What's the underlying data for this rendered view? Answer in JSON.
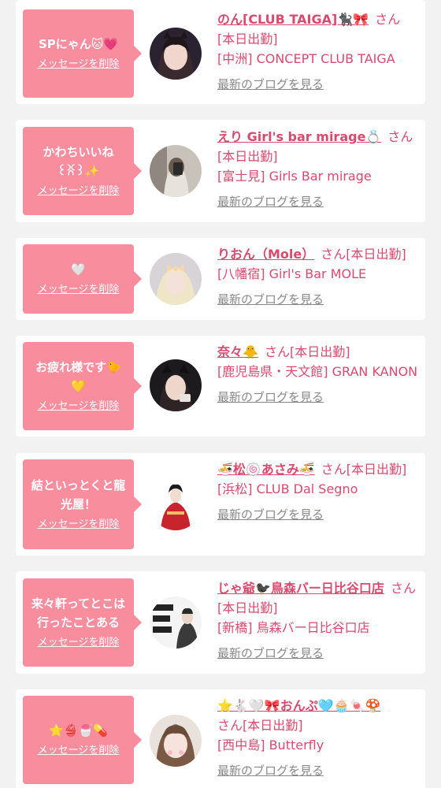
{
  "messages": [
    {
      "message": "SPにゃん🐱💗",
      "delete_label": "メッセージを削除",
      "name": "のん[CLUB TAIGA]🐈‍⬛🎀",
      "san": "さん",
      "status": "[本日出勤]",
      "shop": "[中洲] CONCEPT CLUB TAIGA",
      "blog_label": "最新のブログを見る"
    },
    {
      "message": "かわちいいね\n꒰ꐦ꒱✨",
      "delete_label": "メッセージを削除",
      "name": "えり Girl's bar mirage💍",
      "san": "さん",
      "status": "[本日出勤]",
      "shop": "[富士見] Girls Bar mirage",
      "blog_label": "最新のブログを見る"
    },
    {
      "message": "🤍",
      "delete_label": "メッセージを削除",
      "name": "りおん（Mole）",
      "san": "さん",
      "status": "[本日出勤]",
      "shop": "[八幡宿] Girl's Bar MOLE",
      "blog_label": "最新のブログを見る"
    },
    {
      "message": "お疲れ様です🐤\n💛",
      "delete_label": "メッセージを削除",
      "name": "奈々🐥",
      "san": "さん",
      "status": "[本日出勤]",
      "shop": "[鹿児島県・天文館] GRAN KANON",
      "blog_label": "最新のブログを見る"
    },
    {
      "message": "結といっとくと龍\n光屋！",
      "delete_label": "メッセージを削除",
      "name": "🍜松🍥あさみ🍜",
      "san": "さん",
      "status": "[本日出勤]",
      "shop": "[浜松] CLUB Dal Segno",
      "blog_label": "最新のブログを見る"
    },
    {
      "message": "来々軒ってとこは\n行ったことある",
      "delete_label": "メッセージを削除",
      "name": "じゃ爺🐦‍⬛鳥森バー日比谷口店",
      "san": "さん",
      "status": "[本日出勤]",
      "shop": "[新橋] 鳥森バー日比谷口店",
      "blog_label": "最新のブログを見る"
    },
    {
      "message": "⭐👙🍧💊",
      "delete_label": "メッセージを削除",
      "name": "⭐🐇🤍🎀おんぷ🩵🧁🍬🍄",
      "san": "さん",
      "status": "[本日出勤]",
      "shop": "[西中島] Butterfly",
      "blog_label": "最新のブログを見る"
    }
  ],
  "colors": {
    "bubble": "#f88d9e",
    "accent_text": "#d94a6e",
    "muted_link": "#888888",
    "background": "#f2f2f2",
    "card": "#ffffff"
  }
}
